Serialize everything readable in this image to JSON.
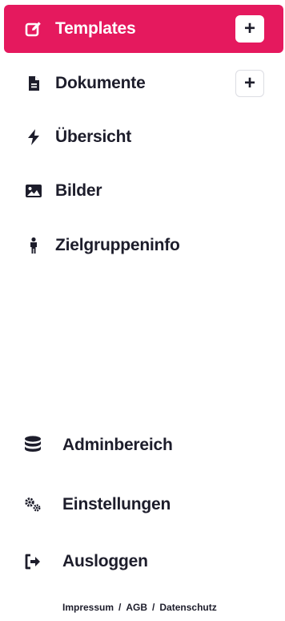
{
  "nav": {
    "items": [
      {
        "label": "Templates",
        "icon": "edit-icon",
        "active": true,
        "add_label": "+"
      },
      {
        "label": "Dokumente",
        "icon": "file-icon",
        "add_label": "+"
      },
      {
        "label": "Übersicht",
        "icon": "bolt-icon"
      },
      {
        "label": "Bilder",
        "icon": "image-icon"
      },
      {
        "label": "Zielgruppeninfo",
        "icon": "person-icon"
      }
    ]
  },
  "bottom": {
    "items": [
      {
        "label": "Adminbereich",
        "icon": "database-icon"
      },
      {
        "label": "Einstellungen",
        "icon": "cogs-icon"
      },
      {
        "label": "Ausloggen",
        "icon": "sign-out-icon"
      }
    ]
  },
  "footer": {
    "impressum": "Impressum",
    "agb": "AGB",
    "datenschutz": "Datenschutz",
    "separator": "/"
  },
  "colors": {
    "accent": "#e5195e",
    "text": "#1d1d2b"
  }
}
